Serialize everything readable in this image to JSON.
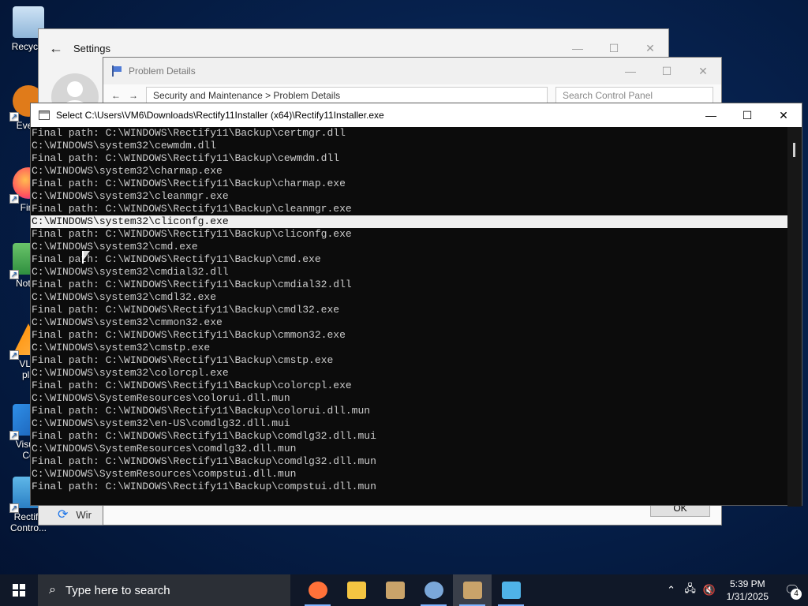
{
  "desktop": {
    "icons": [
      {
        "label": "Recycle",
        "icon": "recycle-bin-icon"
      },
      {
        "label": "Every",
        "icon": "everything-icon"
      },
      {
        "label": "Fire",
        "icon": "firefox-icon"
      },
      {
        "label": "Notep",
        "icon": "notepad-icon"
      },
      {
        "label": "VLC",
        "label2": "pla",
        "icon": "vlc-icon"
      },
      {
        "label": "Visual",
        "label2": "Co",
        "icon": "vscode-icon"
      },
      {
        "label": "Rectify",
        "label2": "Contro...",
        "icon": "rectify-icon"
      }
    ]
  },
  "settings_window": {
    "title": "Settings",
    "back_icon": "back-arrow-icon",
    "bottom_text": "Wir"
  },
  "problem_window": {
    "title": "Problem Details",
    "address": "Security and Maintenance  >  Problem Details",
    "search_placeholder": "Search Control Panel",
    "ok_label": "OK"
  },
  "console_window": {
    "title": "Select C:\\Users\\VM6\\Downloads\\Rectify11Installer (x64)\\Rectify11Installer.exe",
    "selected_line_index": 7,
    "lines": [
      "Final path: C:\\WINDOWS\\Rectify11\\Backup\\certmgr.dll",
      "C:\\WINDOWS\\system32\\cewmdm.dll",
      "Final path: C:\\WINDOWS\\Rectify11\\Backup\\cewmdm.dll",
      "C:\\WINDOWS\\system32\\charmap.exe",
      "Final path: C:\\WINDOWS\\Rectify11\\Backup\\charmap.exe",
      "C:\\WINDOWS\\system32\\cleanmgr.exe",
      "Final path: C:\\WINDOWS\\Rectify11\\Backup\\cleanmgr.exe",
      "C:\\WINDOWS\\system32\\cliconfg.exe",
      "Final path: C:\\WINDOWS\\Rectify11\\Backup\\cliconfg.exe",
      "C:\\WINDOWS\\system32\\cmd.exe",
      "Final path: C:\\WINDOWS\\Rectify11\\Backup\\cmd.exe",
      "C:\\WINDOWS\\system32\\cmdial32.dll",
      "Final path: C:\\WINDOWS\\Rectify11\\Backup\\cmdial32.dll",
      "C:\\WINDOWS\\system32\\cmdl32.exe",
      "Final path: C:\\WINDOWS\\Rectify11\\Backup\\cmdl32.exe",
      "C:\\WINDOWS\\system32\\cmmon32.exe",
      "Final path: C:\\WINDOWS\\Rectify11\\Backup\\cmmon32.exe",
      "C:\\WINDOWS\\system32\\cmstp.exe",
      "Final path: C:\\WINDOWS\\Rectify11\\Backup\\cmstp.exe",
      "C:\\WINDOWS\\system32\\colorcpl.exe",
      "Final path: C:\\WINDOWS\\Rectify11\\Backup\\colorcpl.exe",
      "C:\\WINDOWS\\SystemResources\\colorui.dll.mun",
      "Final path: C:\\WINDOWS\\Rectify11\\Backup\\colorui.dll.mun",
      "C:\\WINDOWS\\system32\\en-US\\comdlg32.dll.mui",
      "Final path: C:\\WINDOWS\\Rectify11\\Backup\\comdlg32.dll.mui",
      "C:\\WINDOWS\\SystemResources\\comdlg32.dll.mun",
      "Final path: C:\\WINDOWS\\Rectify11\\Backup\\comdlg32.dll.mun",
      "C:\\WINDOWS\\SystemResources\\compstui.dll.mun",
      "Final path: C:\\WINDOWS\\Rectify11\\Backup\\compstui.dll.mun"
    ]
  },
  "taskbar": {
    "search_placeholder": "Type here to search",
    "apps": [
      {
        "name": "firefox-icon",
        "color": "#ff7139",
        "running": true,
        "active": false
      },
      {
        "name": "file-explorer-icon",
        "color": "#f4c542",
        "running": false,
        "active": false
      },
      {
        "name": "installer-box-icon",
        "color": "#c9a36a",
        "running": false,
        "active": false
      },
      {
        "name": "settings-gear-icon",
        "color": "#7aa7d9",
        "running": true,
        "active": false
      },
      {
        "name": "installer-box-icon",
        "color": "#c9a36a",
        "running": true,
        "active": true
      },
      {
        "name": "control-panel-icon",
        "color": "#4fb3e8",
        "running": true,
        "active": false
      }
    ],
    "time": "5:39 PM",
    "date": "1/31/2025",
    "notification_count": "4"
  },
  "colors": {
    "console_bg": "#0c0c0c",
    "console_text": "#cccccc",
    "taskbar_bg": "#101828"
  }
}
